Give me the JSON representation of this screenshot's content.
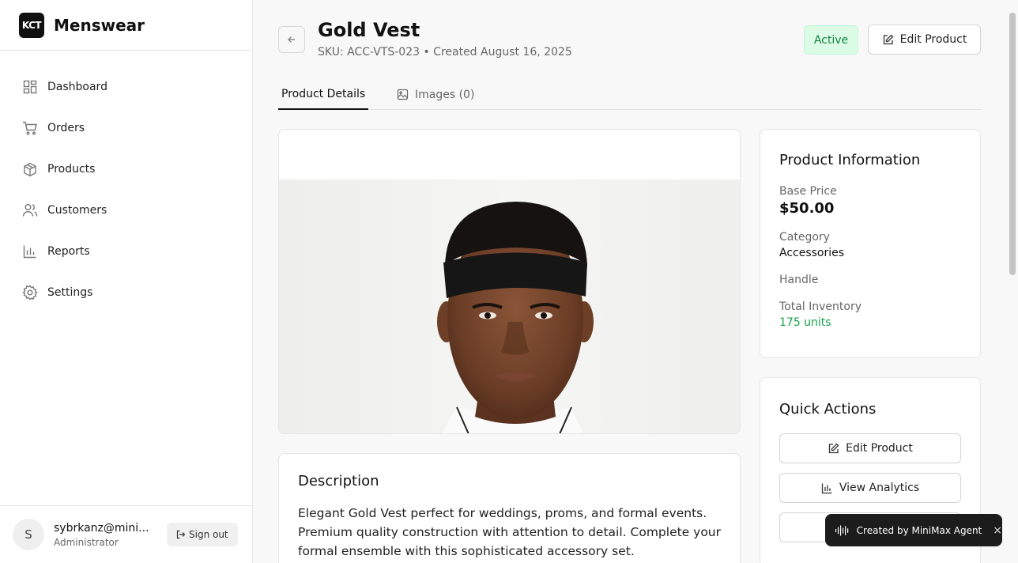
{
  "brand": {
    "logo_text": "KCT",
    "name": "Menswear"
  },
  "sidebar": {
    "items": [
      {
        "label": "Dashboard",
        "icon": "dashboard-icon"
      },
      {
        "label": "Orders",
        "icon": "cart-icon"
      },
      {
        "label": "Products",
        "icon": "package-icon"
      },
      {
        "label": "Customers",
        "icon": "users-icon"
      },
      {
        "label": "Reports",
        "icon": "bar-chart-icon"
      },
      {
        "label": "Settings",
        "icon": "gear-icon"
      }
    ]
  },
  "user": {
    "initial": "S",
    "email": "sybrkanz@mini...",
    "role": "Administrator",
    "signout_label": "Sign out"
  },
  "product": {
    "title": "Gold Vest",
    "subtitle": "SKU: ACC-VTS-023 • Created August 16, 2025",
    "status": "Active",
    "edit_label": "Edit Product"
  },
  "tabs": [
    {
      "label": "Product Details",
      "active": true
    },
    {
      "label": "Images (0)",
      "active": false
    }
  ],
  "description": {
    "title": "Description",
    "text": "Elegant Gold Vest perfect for weddings, proms, and formal events. Premium quality construction with attention to detail. Complete your formal ensemble with this sophisticated accessory set."
  },
  "info": {
    "title": "Product Information",
    "base_price_label": "Base Price",
    "base_price": "$50.00",
    "category_label": "Category",
    "category": "Accessories",
    "handle_label": "Handle",
    "inventory_label": "Total Inventory",
    "inventory": "175 units"
  },
  "quick_actions": {
    "title": "Quick Actions",
    "edit_label": "Edit Product",
    "analytics_label": "View Analytics"
  },
  "toast": {
    "text": "Created by MiniMax Agent",
    "close": "×"
  },
  "colors": {
    "status_green": "#15803d",
    "status_bg": "#dcfce7",
    "inventory_green": "#16a34a"
  }
}
